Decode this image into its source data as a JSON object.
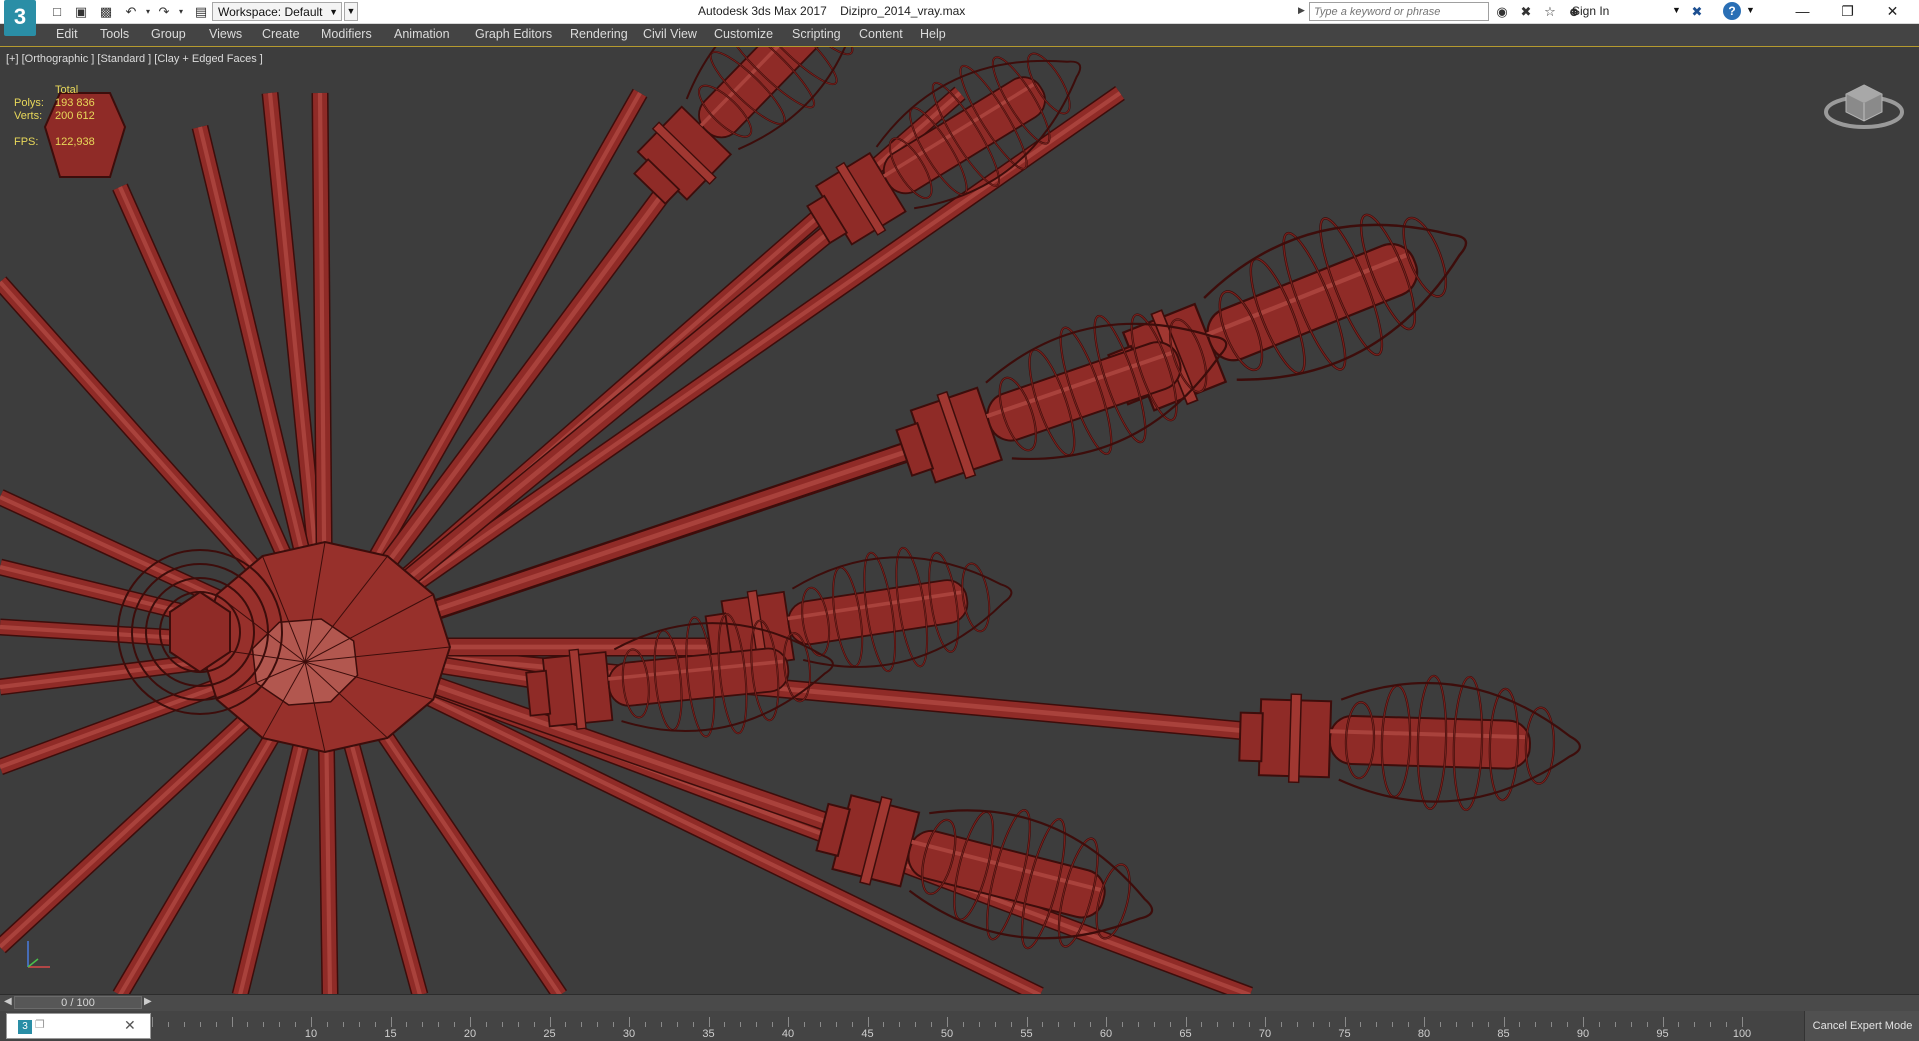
{
  "window": {
    "title": "Autodesk 3ds Max 2017    Dizipro_2014_vray.max",
    "app_icon": "3"
  },
  "toolbar": {
    "workspace_label": "Workspace: Default",
    "search_placeholder": "Type a keyword or phrase",
    "signin_label": "Sign In",
    "help_label": "?"
  },
  "menu": [
    "Edit",
    "Tools",
    "Group",
    "Views",
    "Create",
    "Modifiers",
    "Animation",
    "Graph Editors",
    "Rendering",
    "Civil View",
    "Customize",
    "Scripting",
    "Content",
    "Help"
  ],
  "viewport": {
    "label": "[+] [Orthographic ] [Standard ] [Clay + Edged Faces ]",
    "stats": {
      "total_label": "Total",
      "polys_label": "Polys:",
      "polys_value": "193 836",
      "verts_label": "Verts:",
      "verts_value": "200 612",
      "fps_label": "FPS:",
      "fps_value": "122,938"
    },
    "model_color": "#8f2b27",
    "edge_color": "#3d0d0b",
    "background": "#3d3d3d"
  },
  "timeline": {
    "frame_readout": "0 / 100",
    "ticks": [
      "10",
      "15",
      "20",
      "25",
      "30",
      "35",
      "40",
      "45",
      "50",
      "55",
      "60",
      "65",
      "70",
      "75",
      "80",
      "85",
      "90",
      "95",
      "100"
    ]
  },
  "status": {
    "cancel_expert_label": "Cancel Expert Mode"
  }
}
